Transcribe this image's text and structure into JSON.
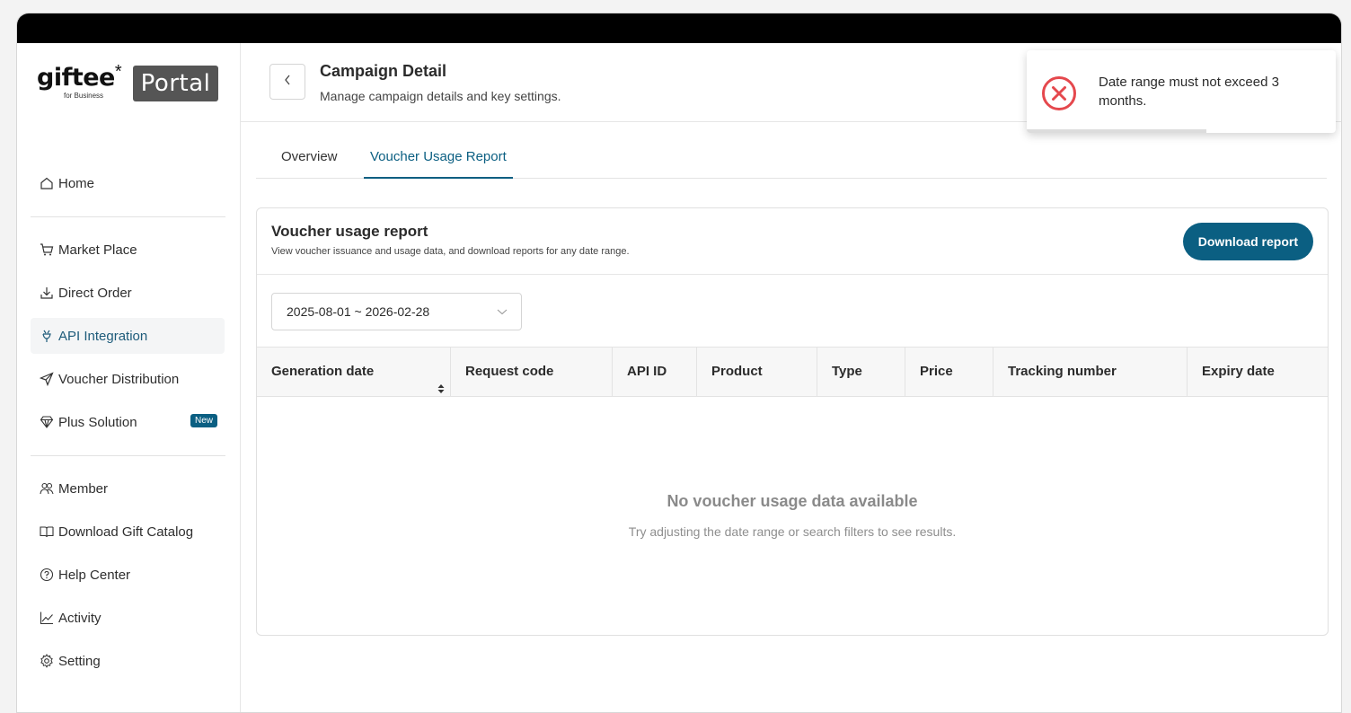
{
  "brand": {
    "wordmark": "giftee",
    "star": "*",
    "sub": "for Business",
    "portal": "Portal"
  },
  "header": {
    "title": "Campaign Detail",
    "subtitle": "Manage campaign details and key settings."
  },
  "tabs": [
    {
      "label": "Overview",
      "active": false
    },
    {
      "label": "Voucher Usage Report",
      "active": true
    }
  ],
  "sidebar": {
    "items": [
      {
        "label": "Home",
        "icon": "home-icon"
      },
      {
        "label": "Market Place",
        "icon": "cart-icon"
      },
      {
        "label": "Direct Order",
        "icon": "download-icon"
      },
      {
        "label": "API Integration",
        "icon": "plug-icon",
        "active": true
      },
      {
        "label": "Voucher Distribution",
        "icon": "send-icon"
      },
      {
        "label": "Plus Solution",
        "icon": "diamond-icon",
        "badge": "New"
      },
      {
        "label": "Member",
        "icon": "users-icon"
      },
      {
        "label": "Download Gift Catalog",
        "icon": "book-icon"
      },
      {
        "label": "Help Center",
        "icon": "help-icon"
      },
      {
        "label": "Activity",
        "icon": "chart-icon"
      },
      {
        "label": "Setting",
        "icon": "gear-icon"
      }
    ]
  },
  "report": {
    "title": "Voucher usage report",
    "description": "View voucher issuance and usage data, and download reports for any date range.",
    "download_label": "Download report",
    "date_range": "2025-08-01 ~ 2026-02-28",
    "columns": [
      "Generation date",
      "Request code",
      "API ID",
      "Product",
      "Type",
      "Price",
      "Tracking number",
      "Expiry date"
    ],
    "empty_title": "No voucher usage data available",
    "empty_sub": "Try adjusting the date range or search filters to see results."
  },
  "toast": {
    "message": "Date range must not exceed 3 months.",
    "type": "error"
  },
  "colors": {
    "accent": "#0b5f82",
    "error": "#e5484d"
  }
}
